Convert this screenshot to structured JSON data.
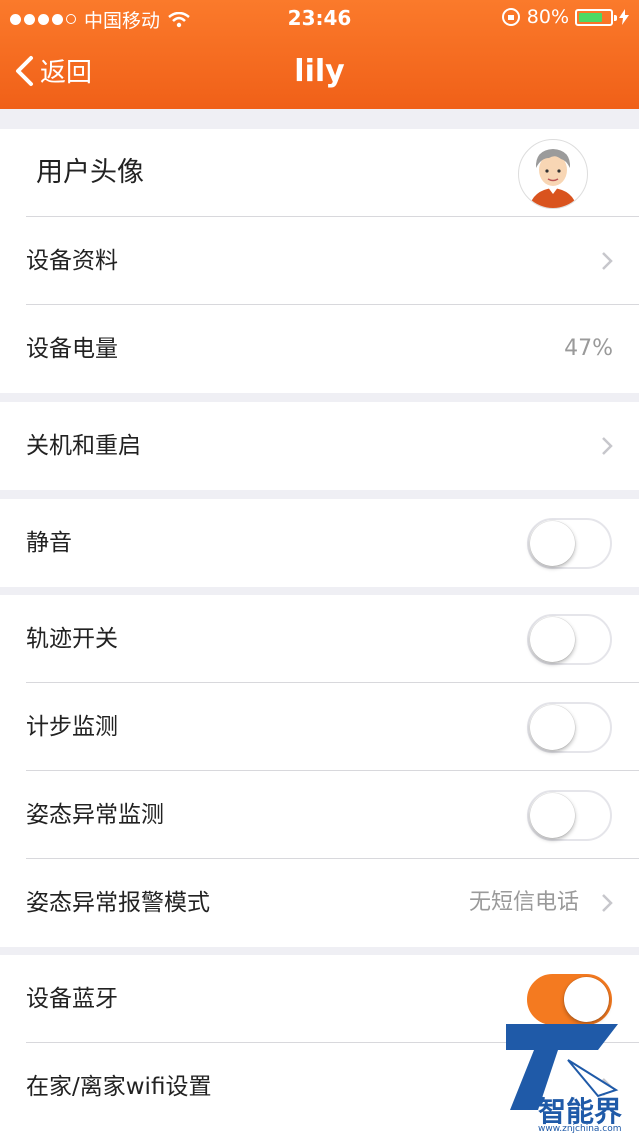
{
  "status_bar": {
    "carrier": "中国移动",
    "time": "23:46",
    "battery": "80%",
    "battery_level": 0.8
  },
  "nav": {
    "back_label": "返回",
    "title": "lily"
  },
  "rows": {
    "avatar_label": "用户头像",
    "device_info": "设备资料",
    "device_battery": "设备电量",
    "device_battery_value": "47%",
    "shutdown_restart": "关机和重启",
    "mute": "静音",
    "track_switch": "轨迹开关",
    "step_monitor": "计步监测",
    "posture_monitor": "姿态异常监测",
    "posture_alarm_mode": "姿态异常报警模式",
    "posture_alarm_mode_value": "无短信电话",
    "bluetooth": "设备蓝牙",
    "wifi_settings": "在家/离家wifi设置"
  },
  "toggles": {
    "mute": false,
    "track_switch": false,
    "step_monitor": false,
    "posture_monitor": false,
    "bluetooth": true
  },
  "watermark": {
    "text": "智能界",
    "url": "www.znjchina.com"
  },
  "colors": {
    "accent": "#f47a20",
    "header_top": "#fb7a2b",
    "header_bottom": "#f06018"
  }
}
